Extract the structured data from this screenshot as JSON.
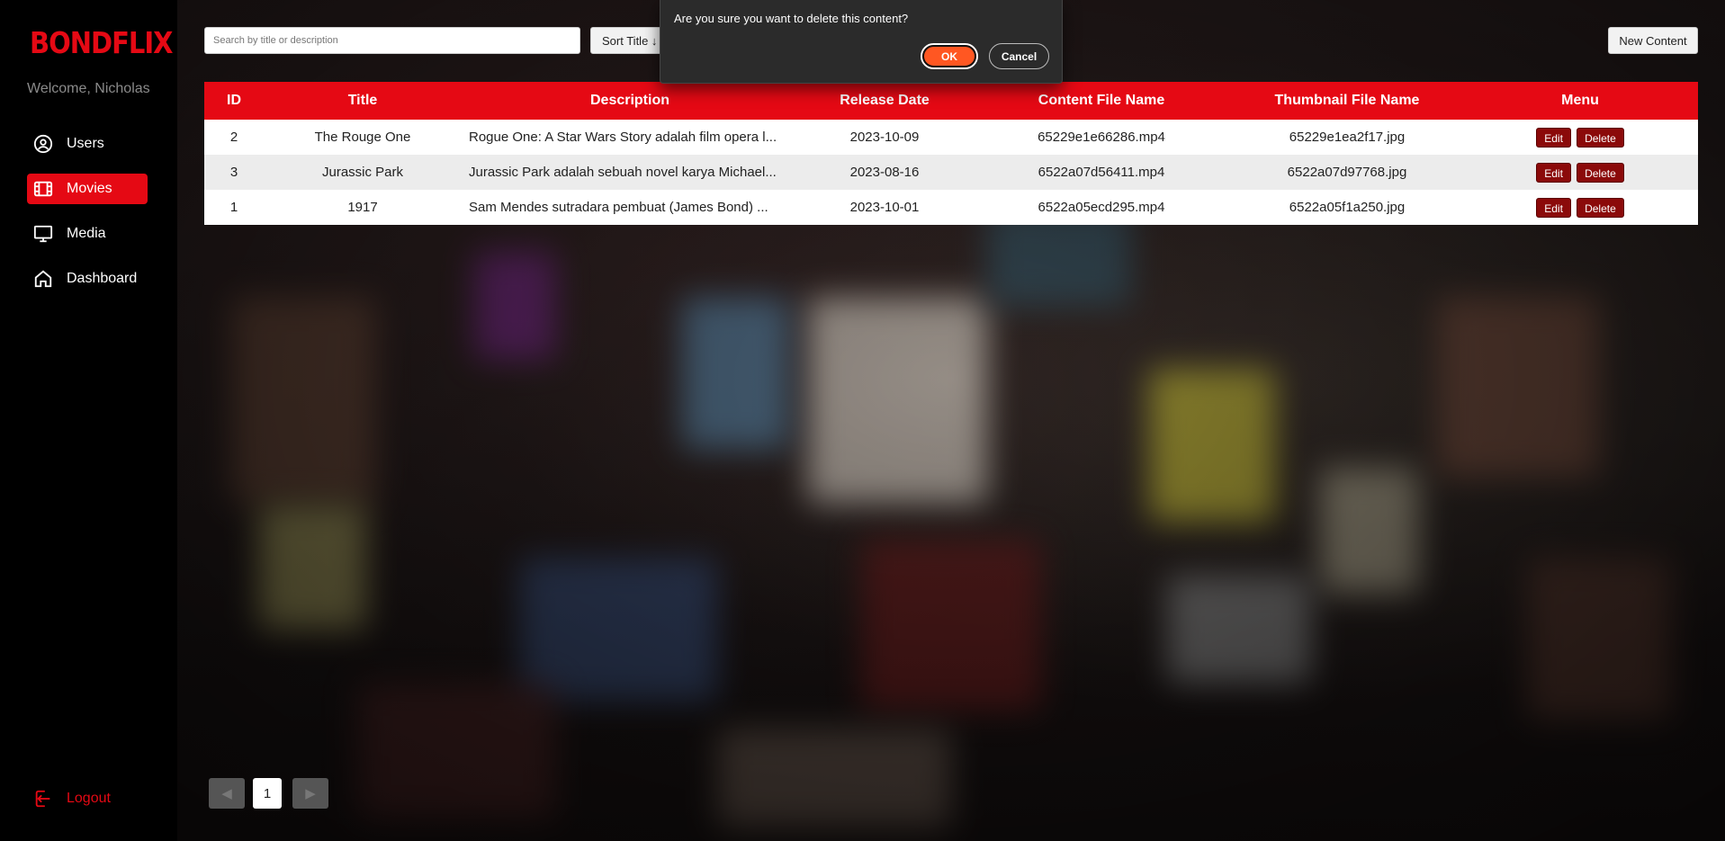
{
  "sidebar": {
    "logo": "BONDFLIX",
    "welcome": "Welcome, Nicholas",
    "items": [
      {
        "label": "Users",
        "icon": "user-circle-icon"
      },
      {
        "label": "Movies",
        "icon": "film-icon",
        "active": true
      },
      {
        "label": "Media",
        "icon": "monitor-icon"
      },
      {
        "label": "Dashboard",
        "icon": "home-icon"
      }
    ],
    "logout": "Logout"
  },
  "toolbar": {
    "search_placeholder": "Search by title or description",
    "sort_label": "Sort Title ↓",
    "new_label": "New Content"
  },
  "table": {
    "headers": [
      "ID",
      "Title",
      "Description",
      "Release Date",
      "Content File Name",
      "Thumbnail File Name",
      "Menu"
    ],
    "rows": [
      {
        "id": "2",
        "title": "The Rouge One",
        "description": "Rogue One: A Star Wars Story adalah film opera l...",
        "release_date": "2023-10-09",
        "content_file": "65229e1e66286.mp4",
        "thumbnail_file": "65229e1ea2f17.jpg"
      },
      {
        "id": "3",
        "title": "Jurassic Park",
        "description": "Jurassic Park adalah sebuah novel karya Michael...",
        "release_date": "2023-08-16",
        "content_file": "6522a07d56411.mp4",
        "thumbnail_file": "6522a07d97768.jpg"
      },
      {
        "id": "1",
        "title": "1917",
        "description": "Sam Mendes sutradara pembuat (James Bond) ...",
        "release_date": "2023-10-01",
        "content_file": "6522a05ecd295.mp4",
        "thumbnail_file": "6522a05f1a250.jpg"
      }
    ],
    "edit_label": "Edit",
    "delete_label": "Delete"
  },
  "pagination": {
    "prev": "◀",
    "current": "1",
    "next": "▶"
  },
  "dialog": {
    "message": "Are you sure you want to delete this content?",
    "ok": "OK",
    "cancel": "Cancel"
  },
  "colors": {
    "brand": "#e50914",
    "ok_button": "#ff5722"
  }
}
